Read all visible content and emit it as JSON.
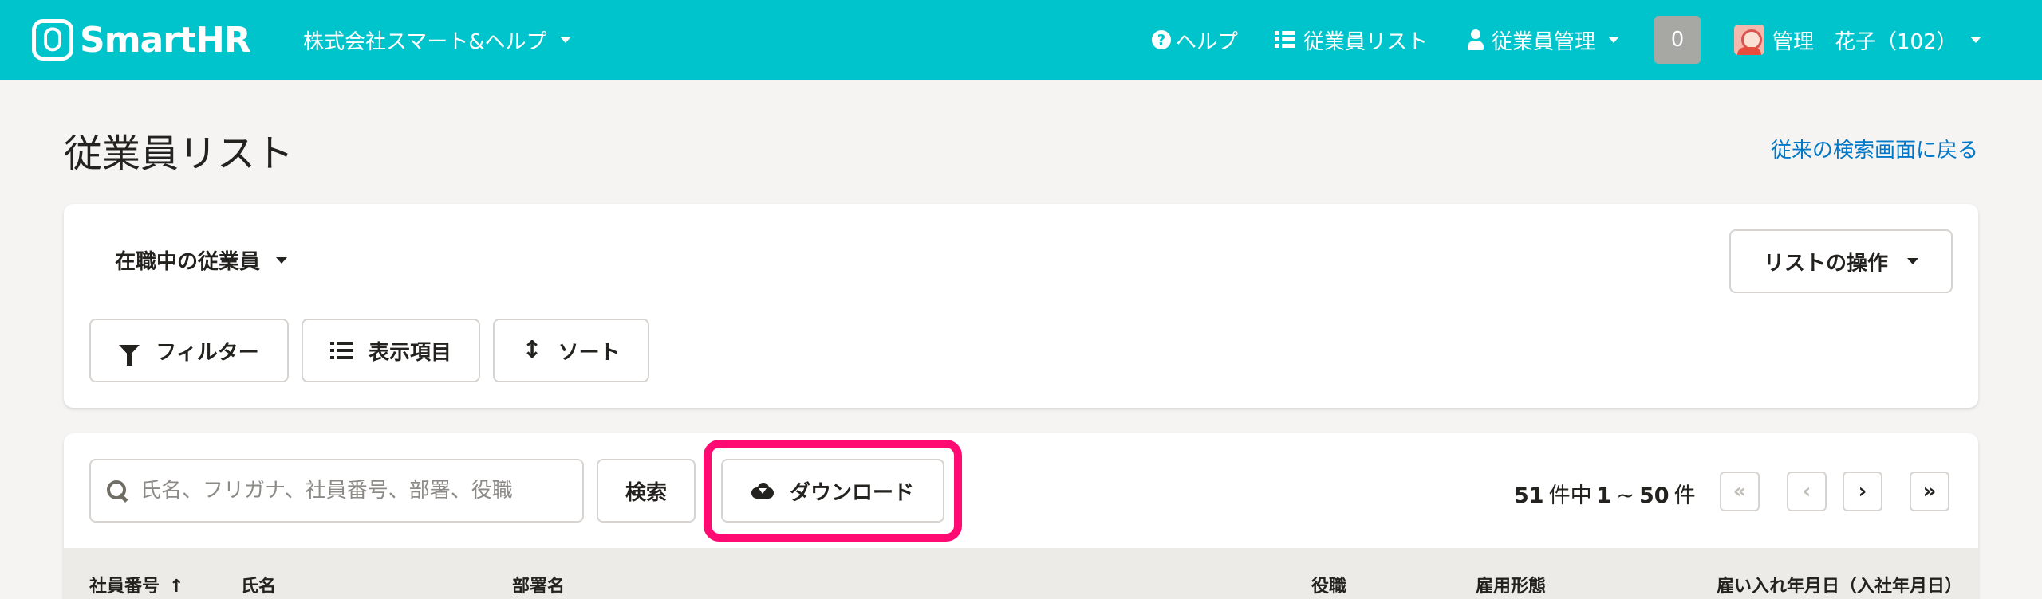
{
  "header": {
    "logo_text": "SmartHR",
    "company": "株式会社スマート&ヘルプ",
    "nav_help": "ヘルプ",
    "nav_employee_list": "従業員リスト",
    "nav_employee_manage": "従業員管理",
    "notification_count": "0",
    "user_name": "管理　花子（102）"
  },
  "page": {
    "title": "従業員リスト",
    "back_link": "従来の検索画面に戻る"
  },
  "toolbar": {
    "view_select": "在職中の従業員",
    "list_ops": "リストの操作",
    "filter": "フィルター",
    "columns": "表示項目",
    "sort": "ソート"
  },
  "search": {
    "placeholder": "氏名、フリガナ、社員番号、部署、役職",
    "search_button": "検索",
    "download_button": "ダウンロード"
  },
  "pagination": {
    "total": "51",
    "of_label": "件中",
    "range_start": "1",
    "range_sep": "~",
    "range_end": "50",
    "unit": "件",
    "first": "«",
    "prev": "‹",
    "next": "›",
    "last": "»"
  },
  "table": {
    "columns": [
      "社員番号",
      "氏名",
      "部署名",
      "役職",
      "雇用形態",
      "雇い入れ年月日（入社年月日）"
    ],
    "sort_indicator": "↑"
  },
  "colors": {
    "header_bg": "#00c4cc",
    "link": "#0077c7",
    "highlight": "#ff0a73"
  }
}
